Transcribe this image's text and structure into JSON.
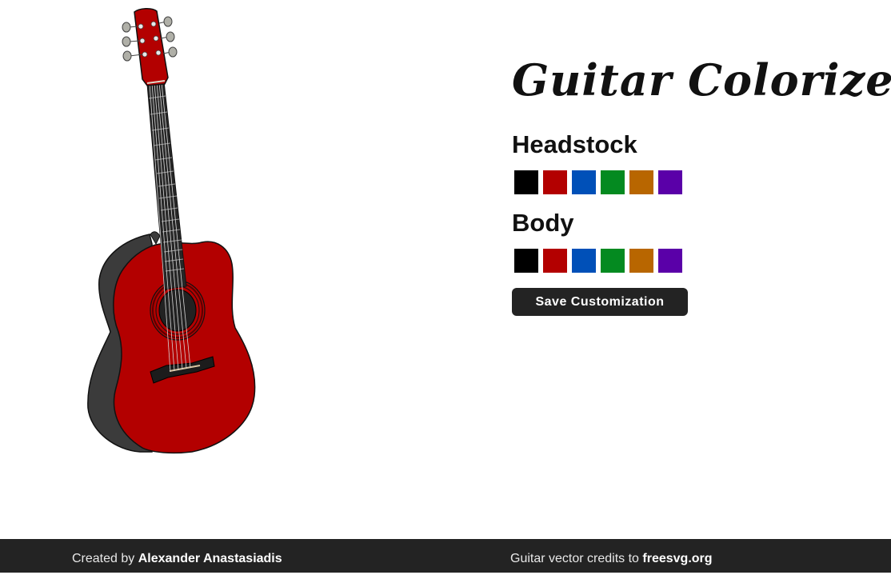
{
  "app": {
    "title": "Guitar Colorizer"
  },
  "sections": [
    {
      "title": "Headstock",
      "swatches": [
        "#000000",
        "#b30000",
        "#0050b8",
        "#048a20",
        "#b86600",
        "#5a00a8"
      ]
    },
    {
      "title": "Body",
      "swatches": [
        "#000000",
        "#b30000",
        "#0050b8",
        "#048a20",
        "#b86600",
        "#5a00a8"
      ]
    }
  ],
  "actions": {
    "save_label": "Save Customization"
  },
  "guitar": {
    "headstock_color": "#b30000",
    "body_color": "#b30000"
  },
  "footer": {
    "left_prefix": "Created by",
    "left_name": "Alexander Anastasiadis",
    "right_prefix": "Guitar vector credits to",
    "right_link": "freesvg.org"
  }
}
